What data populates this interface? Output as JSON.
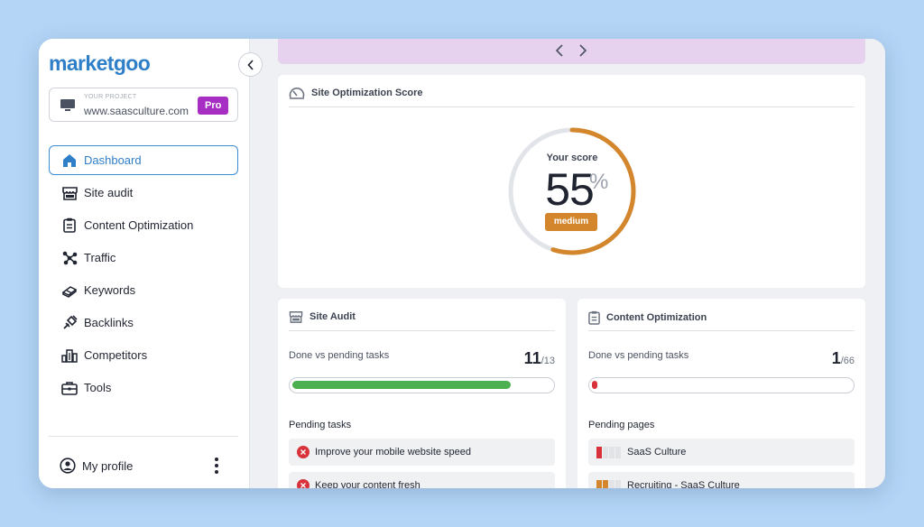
{
  "brand": {
    "logo_text": "marketgoo",
    "accent": "#2f7fc8"
  },
  "project": {
    "caption": "YOUR PROJECT",
    "domain": "www.saasculture.com",
    "plan_badge": "Pro",
    "badge_color": "#a62ec2"
  },
  "sidebar": {
    "items": [
      {
        "label": "Dashboard",
        "icon": "home-icon",
        "active": true
      },
      {
        "label": "Site audit",
        "icon": "storefront-icon",
        "active": false
      },
      {
        "label": "Content Optimization",
        "icon": "clipboard-icon",
        "active": false
      },
      {
        "label": "Traffic",
        "icon": "network-icon",
        "active": false
      },
      {
        "label": "Keywords",
        "icon": "keywords-icon",
        "active": false
      },
      {
        "label": "Backlinks",
        "icon": "plug-link-icon",
        "active": false
      },
      {
        "label": "Competitors",
        "icon": "buildings-icon",
        "active": false
      },
      {
        "label": "Tools",
        "icon": "toolbox-icon",
        "active": false
      }
    ],
    "profile_label": "My profile"
  },
  "score": {
    "title": "Site Optimization Score",
    "caption": "Your score",
    "value": "55",
    "unit": "%",
    "badge": "medium",
    "fraction": 0.55,
    "arc_color": "#d4862c"
  },
  "site_audit": {
    "title": "Site Audit",
    "done_label": "Done vs pending tasks",
    "done": "11",
    "total": "/13",
    "progress": 0.846,
    "bar_color": "#4caf50",
    "pending_label": "Pending tasks",
    "tasks": [
      "Improve your mobile website speed",
      "Keep your content fresh"
    ]
  },
  "content_opt": {
    "title": "Content Optimization",
    "done_label": "Done vs pending tasks",
    "done": "1",
    "total": "/66",
    "progress": 0.015,
    "bar_color": "#d8333a",
    "pending_label": "Pending pages",
    "pages": [
      {
        "name": "SaaS Culture",
        "level": 1,
        "color": "#d8333a"
      },
      {
        "name": "Recruiting - SaaS Culture",
        "level": 2,
        "color": "#d4862c"
      }
    ]
  }
}
